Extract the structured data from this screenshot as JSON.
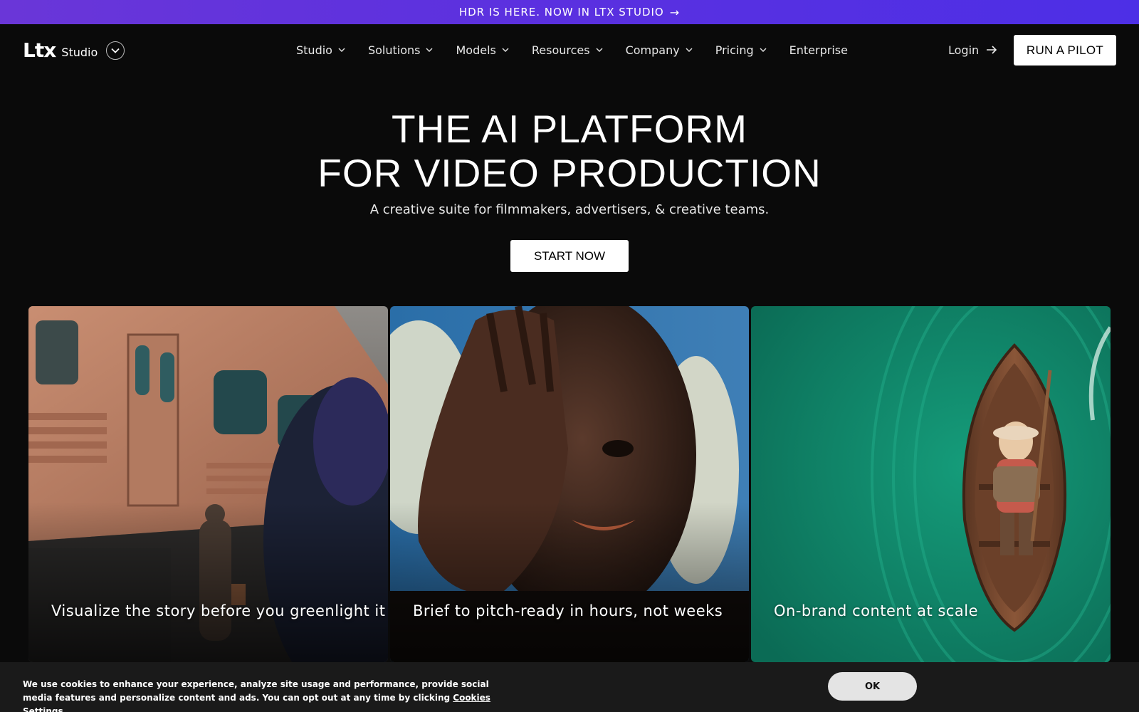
{
  "announcement": {
    "text": "HDR IS HERE. NOW IN LTX STUDIO",
    "arrow": "→"
  },
  "brand": {
    "logo": "Ltx",
    "product": "Studio"
  },
  "nav": {
    "items": [
      {
        "label": "Studio",
        "has_dropdown": true
      },
      {
        "label": "Solutions",
        "has_dropdown": true
      },
      {
        "label": "Models",
        "has_dropdown": true
      },
      {
        "label": "Resources",
        "has_dropdown": true
      },
      {
        "label": "Company",
        "has_dropdown": true
      },
      {
        "label": "Pricing",
        "has_dropdown": true
      },
      {
        "label": "Enterprise",
        "has_dropdown": false
      }
    ],
    "login": "Login",
    "cta": "RUN A PILOT"
  },
  "hero": {
    "title_line1": "THE AI PLATFORM",
    "title_line2": "FOR VIDEO PRODUCTION",
    "subtitle": "A creative suite for filmmakers, advertisers, & creative teams.",
    "cta": "START NOW"
  },
  "cards": [
    {
      "caption": "Visualize the story before you greenlight it"
    },
    {
      "caption": "Brief to pitch-ready in hours, not weeks"
    },
    {
      "caption": "On-brand content at scale"
    }
  ],
  "cookie": {
    "text": "We use cookies to enhance your experience, analyze site usage and performance, provide social media features and personalize content and ads. You can opt out at any time by clicking",
    "link": "Cookies Settings",
    "ok": "OK"
  },
  "colors": {
    "announcement_bg": "#5a30e0",
    "page_bg": "#0a0a0a",
    "card3_bg": "#0f8a6a"
  }
}
